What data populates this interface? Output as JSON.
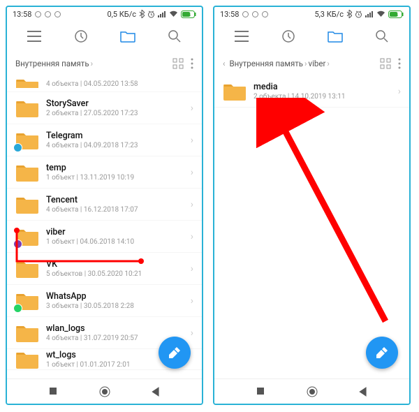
{
  "left": {
    "status": {
      "time": "13:58",
      "network": "0,5 КБ/с"
    },
    "breadcrumb": {
      "root": "Внутренняя память"
    },
    "partial_top": {
      "meta": "4 объекта  |  04.05.2020 13:58"
    },
    "folders": [
      {
        "name": "StorySaver",
        "meta": "2 объекта  |  27.05.2020 17:23",
        "badge": ""
      },
      {
        "name": "Telegram",
        "meta": "4 объекта  |  04.09.2018 17:23",
        "badge": "#2aa8d8"
      },
      {
        "name": "temp",
        "meta": "1 объект  |  13.11.2019 10:19",
        "badge": ""
      },
      {
        "name": "Tencent",
        "meta": "4 объекта  |  16.12.2018 17:07",
        "badge": ""
      },
      {
        "name": "viber",
        "meta": "1 объект  |  04.06.2018 14:10",
        "badge": "#7b3fb3"
      },
      {
        "name": "VK",
        "meta": "5 объектов  |  30.05.2020 10:21",
        "badge": ""
      },
      {
        "name": "WhatsApp",
        "meta": "3 объекта  |  30.05.2018 2:28",
        "badge": "#25d366"
      },
      {
        "name": "wlan_logs",
        "meta": "4 объекта  |  31.07.2019 20:57",
        "badge": ""
      }
    ],
    "partial_bottom": {
      "name": "wt_logs",
      "meta": "1 объект | 01.01.2017 2:01"
    }
  },
  "right": {
    "status": {
      "time": "13:58",
      "network": "5,3 КБ/с"
    },
    "breadcrumb": {
      "root": "Внутренняя память",
      "sub": "viber"
    },
    "folders": [
      {
        "name": "media",
        "meta": "2 объекта  |  14.10.2019 13:11",
        "badge": ""
      }
    ]
  }
}
